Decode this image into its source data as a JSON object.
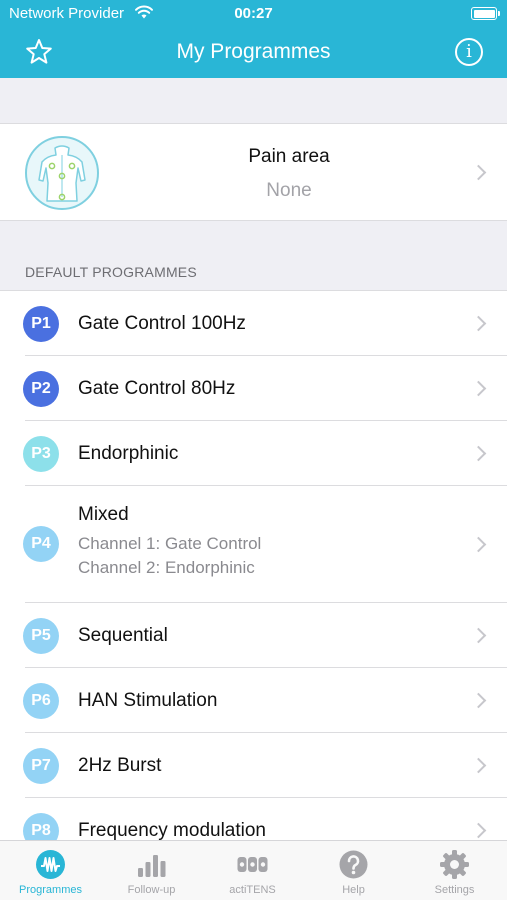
{
  "status_bar": {
    "carrier": "Network Provider",
    "time": "00:27"
  },
  "nav": {
    "title": "My Programmes",
    "left_icon": "star-icon",
    "right_icon": "info-icon",
    "info_glyph": "i"
  },
  "pain_area": {
    "title": "Pain area",
    "value": "None"
  },
  "section_header": "DEFAULT PROGRAMMES",
  "programmes": [
    {
      "badge": "P1",
      "name": "Gate Control 100Hz",
      "color": "#4a70e0"
    },
    {
      "badge": "P2",
      "name": "Gate Control 80Hz",
      "color": "#4a70e0"
    },
    {
      "badge": "P3",
      "name": "Endorphinic",
      "color": "#8de0ea"
    },
    {
      "badge": "P4",
      "name": "Mixed",
      "sub1": "Channel 1: Gate Control",
      "sub2": "Channel 2: Endorphinic",
      "color": "#93d3f5"
    },
    {
      "badge": "P5",
      "name": "Sequential",
      "color": "#93d3f5"
    },
    {
      "badge": "P6",
      "name": "HAN Stimulation",
      "color": "#93d3f5"
    },
    {
      "badge": "P7",
      "name": "2Hz Burst",
      "color": "#93d3f5"
    },
    {
      "badge": "P8",
      "name": "Frequency modulation",
      "color": "#93d3f5"
    }
  ],
  "tabs": [
    {
      "label": "Programmes",
      "icon": "waveform-icon",
      "active": true
    },
    {
      "label": "Follow-up",
      "icon": "bar-chart-icon",
      "active": false
    },
    {
      "label": "actiTENS",
      "icon": "device-icon",
      "active": false
    },
    {
      "label": "Help",
      "icon": "question-icon",
      "active": false
    },
    {
      "label": "Settings",
      "icon": "gear-icon",
      "active": false
    }
  ],
  "colors": {
    "accent": "#29b6d6",
    "background": "#efeff4",
    "inactive": "#a5a5a9"
  }
}
